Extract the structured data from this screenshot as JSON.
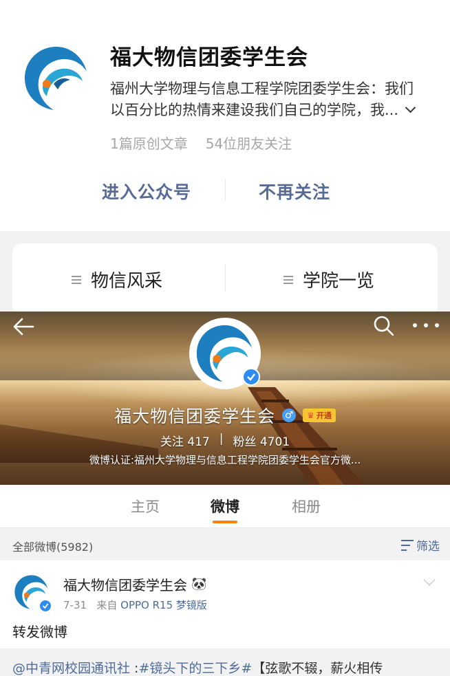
{
  "wechat": {
    "account_name": "福大物信团委学生会",
    "desc_line1": "福州大学物理与信息工程学院团委学生会：我们",
    "desc_line2": "以百分比的热情来建设我们自己的学院，我...",
    "articles": "1篇原创文章",
    "followers": "54位朋友关注",
    "enter_label": "进入公众号",
    "unfollow_label": "不再关注"
  },
  "menu": {
    "left_label": "物信风采",
    "right_label": "学院一览"
  },
  "weibo": {
    "name": "福大物信团委学生会",
    "gender_symbol": "♂",
    "vip_label": "开通",
    "following_label": "关注",
    "following_count": "417",
    "divider": "|",
    "fans_label": "粉丝",
    "fans_count": "4701",
    "verification": "微博认证:福州大学物理与信息工程学院团委学生会官方微...",
    "tabs": {
      "home": "主页",
      "weibo": "微博",
      "album": "相册"
    },
    "filter": {
      "all": "全部微博(5982)",
      "filter_label": "筛选"
    },
    "post": {
      "author": "福大物信团委学生会",
      "date": "7-31",
      "from_label": "来自",
      "source": "OPPO R15 梦镜版",
      "text": "转发微博",
      "repost_mention": "@中青网校园通讯社",
      "repost_sep": " :",
      "repost_tag": "#镜头下的三下乡#",
      "repost_rest": "【弦歌不辍，薪火相传"
    }
  },
  "colors": {
    "link_blue": "#576b95",
    "weibo_blue": "#4d6b9a",
    "tab_accent": "#ff8200",
    "verify_blue": "#2e8cf0"
  }
}
